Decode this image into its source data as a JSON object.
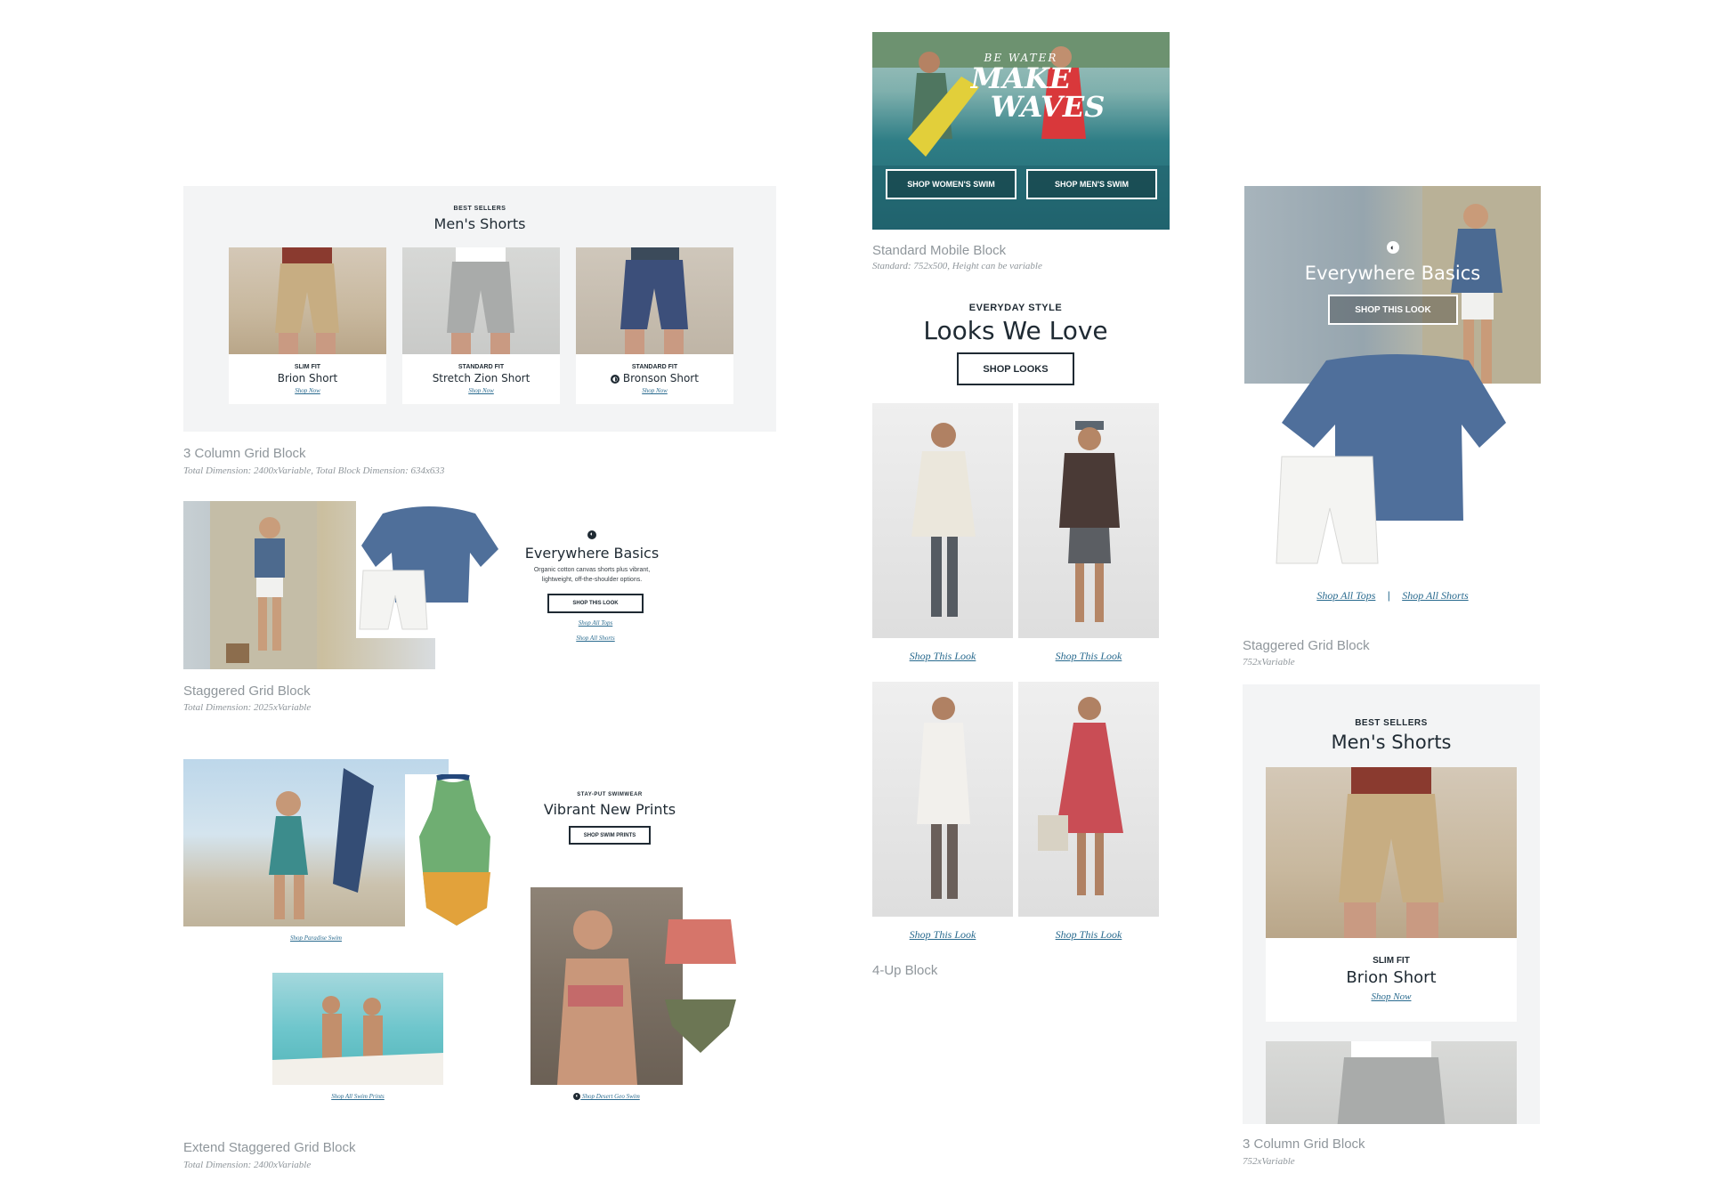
{
  "block_3col": {
    "eyebrow": "BEST SELLERS",
    "title": "Men's Shorts",
    "products": [
      {
        "fit": "SLIM FIT",
        "name": "Brion Short",
        "link": "Shop Now"
      },
      {
        "fit": "STANDARD FIT",
        "name": "Stretch Zion Short",
        "link": "Shop Now"
      },
      {
        "fit": "STANDARD FIT",
        "name": "Bronson Short",
        "link": "Shop Now"
      }
    ],
    "caption": "3 Column Grid Block",
    "subcaption": "Total Dimension: 2400xVariable, Total Block Dimension: 634x633"
  },
  "block_staggered_desktop": {
    "title": "Everywhere Basics",
    "body": "Organic cotton canvas shorts plus vibrant, lightweight, off-the-shoulder options.",
    "button": "SHOP THIS LOOK",
    "link_tops": "Shop All Tops",
    "link_shorts": "Shop All Shorts",
    "caption": "Staggered Grid Block",
    "subcaption": "Total Dimension: 2025xVariable"
  },
  "block_extend": {
    "eyebrow": "STAY-PUT SWIMWEAR",
    "title": "Vibrant New Prints",
    "button": "SHOP SWIM PRINTS",
    "link_paradise": "Shop Paradise Swim",
    "link_all_swim": "Shop All Swim Prints",
    "link_desert": "Shop Desert Geo Swim",
    "caption": "Extend Staggered Grid Block",
    "subcaption": "Total Dimension: 2400xVariable"
  },
  "block_mobile_hero": {
    "script_small": "BE WATER",
    "script_line1": "MAKE",
    "script_line2": "WAVES",
    "btn_womens": "SHOP WOMEN'S SWIM",
    "btn_mens": "SHOP MEN'S SWIM",
    "caption": "Standard Mobile Block",
    "subcaption": "Standard: 752x500, Height can be variable"
  },
  "block_4up": {
    "eyebrow": "EVERYDAY STYLE",
    "title": "Looks We Love",
    "button": "SHOP LOOKS",
    "links": [
      "Shop This Look",
      "Shop This Look",
      "Shop This Look",
      "Shop This Look"
    ],
    "caption": "4-Up Block"
  },
  "block_staggered_mobile": {
    "title": "Everywhere Basics",
    "button": "SHOP THIS LOOK",
    "link_tops": "Shop All Tops",
    "separator": "|",
    "link_shorts": "Shop All Shorts",
    "caption": "Staggered Grid Block",
    "subcaption": "752xVariable"
  },
  "block_3col_mobile": {
    "eyebrow": "BEST SELLERS",
    "title": "Men's Shorts",
    "product_fit": "SLIM FIT",
    "product_name": "Brion Short",
    "product_link": "Shop Now",
    "caption": "3 Column Grid Block",
    "subcaption": "752xVariable"
  },
  "colors": {
    "link": "#2a6b8f",
    "ink": "#1f2a33",
    "panel": "#f3f4f5",
    "caption": "#8f969b"
  }
}
